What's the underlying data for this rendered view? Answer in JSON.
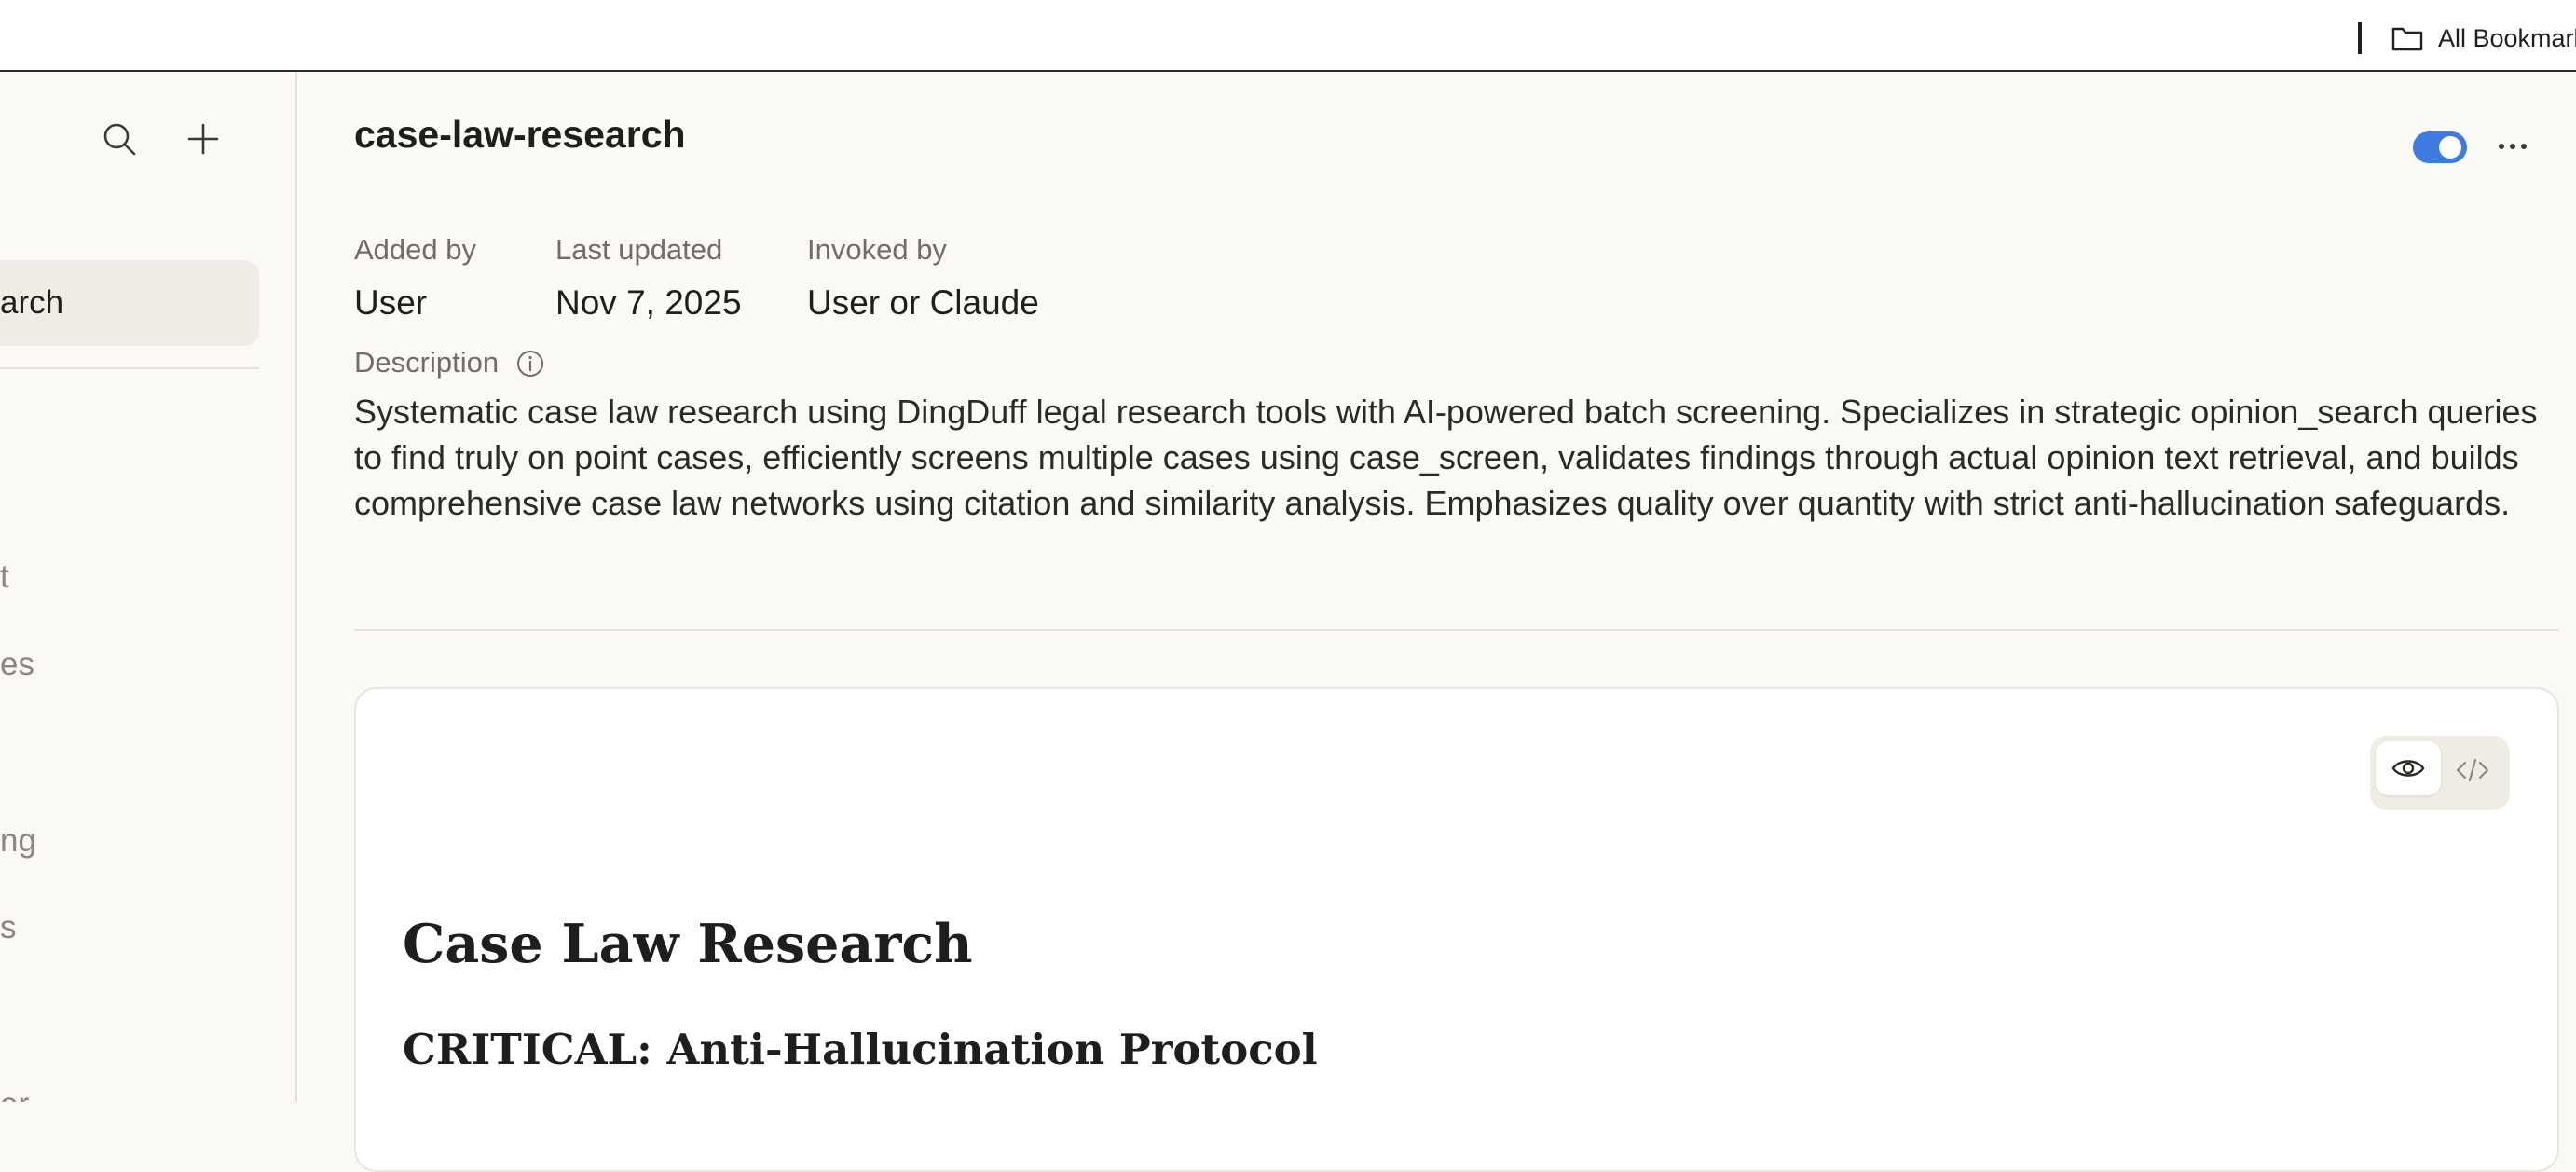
{
  "bookmarks_bar": {
    "all_bookmarks_label": "All Bookmarks"
  },
  "sidebar": {
    "active_item_label": "arch",
    "items": [
      {
        "label": "t"
      },
      {
        "label": "es"
      },
      {
        "label": "ng"
      },
      {
        "label": "s"
      },
      {
        "label": "er"
      }
    ]
  },
  "skill": {
    "title": "case-law-research",
    "enabled": true,
    "meta": [
      {
        "label": "Added by",
        "value": "User"
      },
      {
        "label": "Last updated",
        "value": "Nov 7, 2025"
      },
      {
        "label": "Invoked by",
        "value": "User or Claude"
      }
    ],
    "description_label": "Description",
    "description": "Systematic case law research using DingDuff legal research tools with AI-powered batch screening. Specializes in strategic opinion_search queries to find truly on point cases, efficiently screens multiple cases using case_screen, validates findings through actual opinion text retrieval, and builds comprehensive case law networks using citation and similarity analysis. Emphasizes quality over quantity with strict anti-hallucination safeguards."
  },
  "document": {
    "view_mode": "preview",
    "heading1": "Case Law Research",
    "heading2": "CRITICAL: Anti-Hallucination Protocol"
  },
  "colors": {
    "accent": "#3d7be0",
    "background": "#faf9f5",
    "card": "#ffffff"
  },
  "icons": {
    "bookmarks": "folder-icon",
    "search": "search-icon",
    "add": "plus-icon",
    "more": "more-icon",
    "info": "info-icon",
    "preview": "eye-icon",
    "code": "code-icon"
  }
}
